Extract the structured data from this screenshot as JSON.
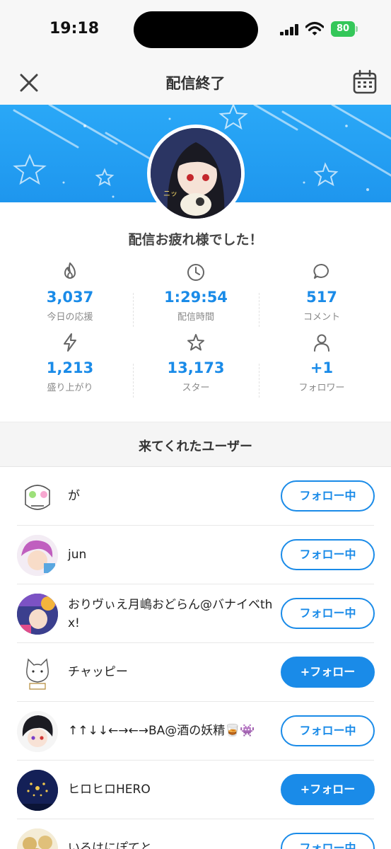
{
  "status_bar": {
    "time": "19:18",
    "battery": "80"
  },
  "header": {
    "title": "配信終了",
    "close_icon": "close-icon",
    "calendar_icon": "calendar-icon"
  },
  "banner": {
    "color": "#2aa8f7"
  },
  "thanks_message": "配信お疲れ様でした！",
  "stats": [
    {
      "icon": "flame-icon",
      "value": "3,037",
      "label": "今日の応援"
    },
    {
      "icon": "clock-icon",
      "value": "1:29:54",
      "label": "配信時間"
    },
    {
      "icon": "comment-icon",
      "value": "517",
      "label": "コメント"
    },
    {
      "icon": "lightning-icon",
      "value": "1,213",
      "label": "盛り上がり"
    },
    {
      "icon": "star-icon",
      "value": "13,173",
      "label": "スター"
    },
    {
      "icon": "person-icon",
      "value": "+1",
      "label": "フォロワー"
    }
  ],
  "section_title": "来てくれたユーザー",
  "users": [
    {
      "name": "が",
      "button": "フォロー中",
      "following": true
    },
    {
      "name": "jun",
      "button": "フォロー中",
      "following": true
    },
    {
      "name": "おりヴぃえ月嶋おどらん@バナイベthx!",
      "button": "フォロー中",
      "following": true
    },
    {
      "name": "チャッピー",
      "button": "+フォロー",
      "following": false
    },
    {
      "name": "↑↑↓↓←→←→BA@酒の妖精🥃👾",
      "button": "フォロー中",
      "following": true
    },
    {
      "name": "ヒロヒロHERO",
      "button": "+フォロー",
      "following": false
    },
    {
      "name": "いろはにぽてと",
      "button": "フォロー中",
      "following": true
    }
  ],
  "accent_color": "#1a8be8"
}
